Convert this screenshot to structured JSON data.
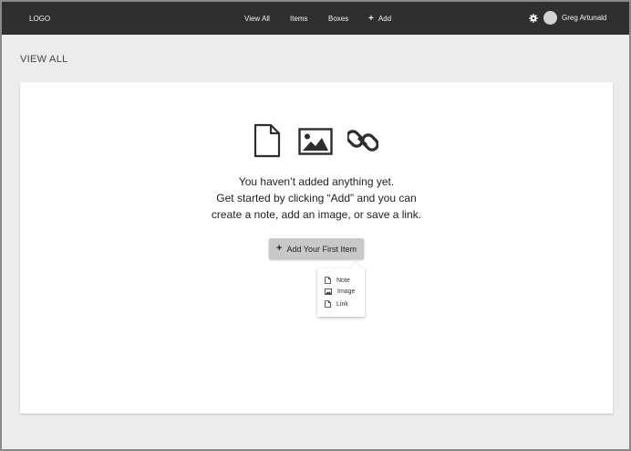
{
  "header": {
    "logo": "LOGO",
    "nav": [
      {
        "label": "View All"
      },
      {
        "label": "Items"
      },
      {
        "label": "Boxes"
      },
      {
        "label": "Add",
        "icon": "plus-icon"
      }
    ],
    "user": {
      "name": "Greg Artunald",
      "settings_icon": "gear-icon"
    }
  },
  "page": {
    "title": "VIEW ALL"
  },
  "empty_state": {
    "icons": [
      "document-icon",
      "image-icon",
      "link-icon"
    ],
    "line1": "You haven’t added anything yet.",
    "line2": "Get started by clicking “Add” and you can",
    "line3": "create a note, add an image, or save a link.",
    "button_label": "Add Your First Item"
  },
  "add_menu": {
    "items": [
      {
        "label": "Note",
        "icon": "document-icon"
      },
      {
        "label": "Image",
        "icon": "image-icon"
      },
      {
        "label": "Link",
        "icon": "document-icon"
      }
    ]
  },
  "colors": {
    "topbar": "#2f2f2f",
    "page_bg": "#ececec",
    "card_bg": "#ffffff",
    "button_bg": "#c8c8c8"
  }
}
